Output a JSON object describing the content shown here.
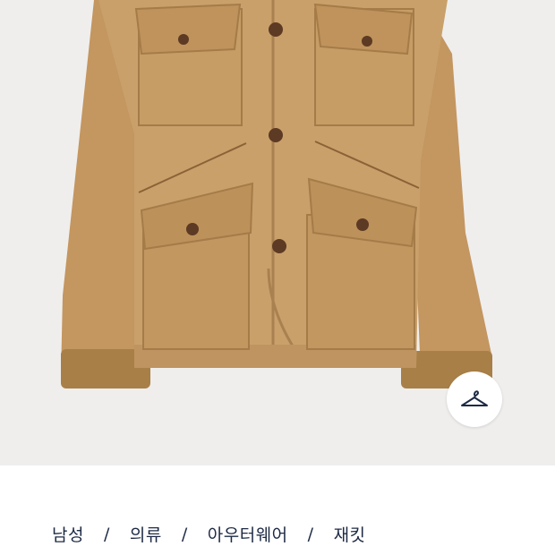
{
  "product": {
    "image_alt": "tan field jacket with four patch pockets, buttons and corduroy cuffs",
    "hanger_icon": "hanger-icon"
  },
  "breadcrumb": {
    "separator": "/",
    "items": [
      {
        "label": "남성"
      },
      {
        "label": "의류"
      },
      {
        "label": "아우터웨어"
      },
      {
        "label": "재킷"
      }
    ]
  },
  "colors": {
    "background": "#efeeed",
    "jacket": "#c59a63",
    "corduroy": "#a97f48",
    "text": "#1d2a44"
  }
}
